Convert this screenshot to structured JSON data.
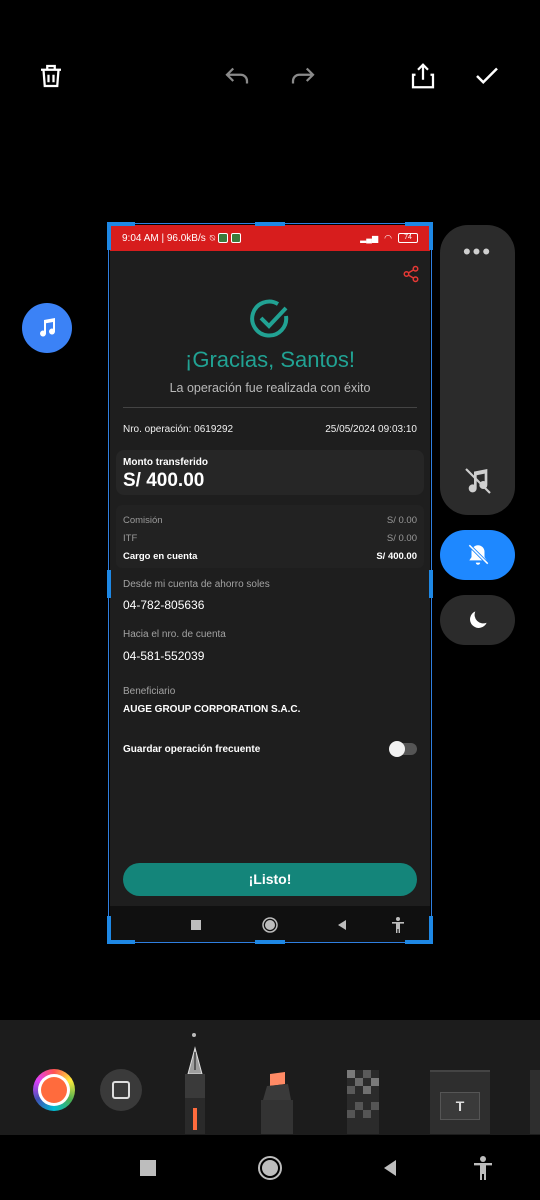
{
  "editor": {
    "toolbar_icons": [
      "trash-icon",
      "undo-icon",
      "redo-icon",
      "share-icon",
      "check-icon"
    ]
  },
  "side_panel": {
    "dots": "•••",
    "icons": [
      "music-off-icon",
      "bell-off-icon",
      "moon-icon"
    ],
    "accent": "#1e88ff"
  },
  "screenshot": {
    "status_bar": {
      "time_speed": "9:04 AM | 96.0kB/s",
      "battery": "74",
      "color": "#d71d1d"
    },
    "thanks_title": "¡Gracias, Santos!",
    "subtitle": "La operación fue realizada con éxito",
    "operation_number": "Nro. operación: 0619292",
    "datetime": "25/05/2024 09:03:10",
    "amount_label": "Monto transferido",
    "amount_value": "S/ 400.00",
    "fees": [
      {
        "label": "Comisión",
        "value": "S/ 0.00"
      },
      {
        "label": "ITF",
        "value": "S/ 0.00"
      },
      {
        "label": "Cargo en cuenta",
        "value": "S/ 400.00"
      }
    ],
    "from_label": "Desde mi cuenta de ahorro soles",
    "from_account": "04-782-805636",
    "to_label": "Hacia el nro. de cuenta",
    "to_account": "04-581-552039",
    "beneficiary_label": "Beneficiario",
    "beneficiary_name": "AUGE GROUP CORPORATION S.A.C.",
    "save_frequent_label": "Guardar operación frecuente",
    "save_frequent_on": false,
    "done_button": "¡Listo!",
    "accent_color": "#21a293"
  },
  "tools": {
    "selected_color": "#ff6b3d",
    "items": [
      "color-picker",
      "shape",
      "pen",
      "highlighter",
      "mosaic",
      "text"
    ]
  }
}
